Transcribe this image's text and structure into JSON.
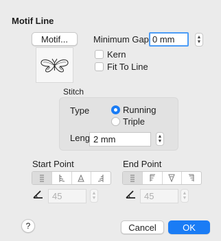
{
  "dialog": {
    "title": "Motif Line"
  },
  "motif": {
    "button_label": "Motif..."
  },
  "gap": {
    "label": "Minimum Gap",
    "value": "0 mm"
  },
  "options": {
    "kern_label": "Kern",
    "fit_label": "Fit To Line"
  },
  "stitch": {
    "group_label": "Stitch",
    "type_label": "Type",
    "running_label": "Running",
    "triple_label": "Triple",
    "selected": "Running",
    "length_label": "Length",
    "length_value": "2 mm"
  },
  "start_point": {
    "label": "Start Point",
    "angle_value": "45"
  },
  "end_point": {
    "label": "End Point",
    "angle_value": "45"
  },
  "footer": {
    "help_label": "?",
    "cancel_label": "Cancel",
    "ok_label": "OK"
  },
  "colors": {
    "accent": "#1a7cf5",
    "focus_ring": "#4b9cf6",
    "background": "#ebebeb"
  }
}
